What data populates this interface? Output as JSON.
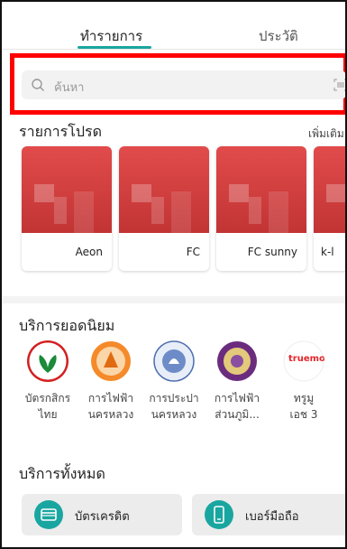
{
  "tabs": {
    "active": "ทำรายการ",
    "history": "ประวัติ"
  },
  "search": {
    "placeholder": "ค้นหา"
  },
  "favorites": {
    "title": "รายการโปรด",
    "more": "เพิ่มเติม",
    "items": [
      {
        "label": "Aeon"
      },
      {
        "label": "FC"
      },
      {
        "label": "FC sunny"
      },
      {
        "label": "k-l"
      }
    ]
  },
  "popular": {
    "title": "บริการยอดนิยม",
    "items": [
      {
        "line1": "บัตรกสิกร",
        "line2": "ไทย"
      },
      {
        "line1": "การไฟฟ้า",
        "line2": "นครหลวง"
      },
      {
        "line1": "การประปา",
        "line2": "นครหลวง"
      },
      {
        "line1": "การไฟฟ้า",
        "line2": "ส่วนภูมิ..."
      },
      {
        "line1": "ทรูมู",
        "line2": "เอช 3",
        "logo_text": "truemo"
      }
    ]
  },
  "all_services": {
    "title": "บริการทั้งหมด",
    "items": [
      {
        "label": "บัตรเครดิต"
      },
      {
        "label": "เบอร์มือถือ"
      }
    ]
  },
  "colors": {
    "accent": "#1aa6a0",
    "card_red": "#d03d3d",
    "highlight": "#ff0000"
  }
}
